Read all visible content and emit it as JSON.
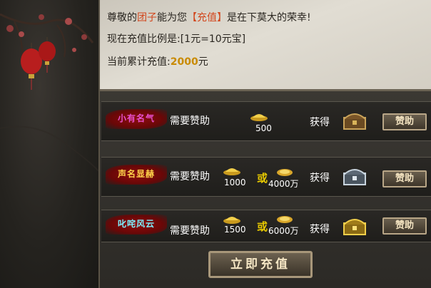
{
  "intro": {
    "line1_prefix": "尊敬的",
    "player_name": "团子",
    "line1_mid": "能为您",
    "recharge_tag": "【充值】",
    "line1_suffix": "是在下莫大的荣幸!",
    "line2": "现在充值比例是:[1元=10元宝]",
    "line3_prefix": "当前累计充值:",
    "total_amount": "2000",
    "line3_suffix": "元"
  },
  "tiers": [
    {
      "title": "小有名气",
      "need_label": "需要赞助",
      "yuanbao": "500",
      "gold": "",
      "get_label": "获得",
      "button_label": "赞助"
    },
    {
      "title": "声名显赫",
      "need_label": "需要赞助",
      "yuanbao": "1000",
      "or_label": "或",
      "gold": "4000万",
      "get_label": "获得",
      "button_label": "赞助"
    },
    {
      "title": "叱咤风云",
      "need_label": "需要赞助",
      "yuanbao": "1500",
      "or_label": "或",
      "gold": "6000万",
      "get_label": "获得",
      "button_label": "赞助"
    }
  ],
  "recharge_button": "立即充值",
  "colors": {
    "highlight": "#d2461c",
    "amount": "#c98a00",
    "or": "#e6c800",
    "tier1": "#e84fd0",
    "tier2": "#ffd24a",
    "tier3": "#7cf0ff"
  },
  "icons": [
    "plum-branch",
    "red-lantern",
    "gold-ingot-icon",
    "gold-coin-icon",
    "bronze-chest-icon",
    "silver-chest-icon",
    "gold-chest-icon"
  ]
}
